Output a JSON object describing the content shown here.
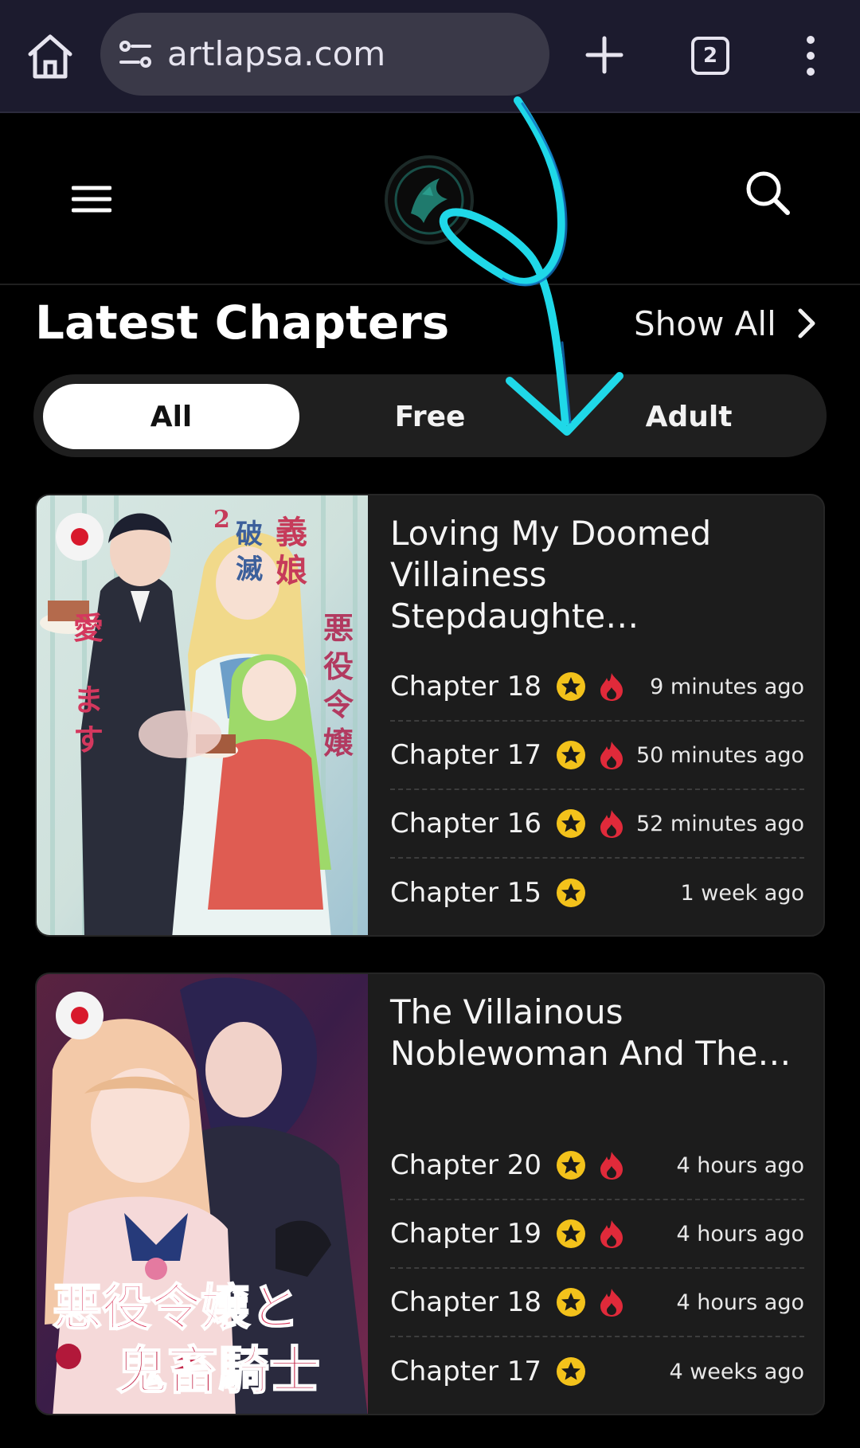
{
  "browser": {
    "url": "artlapsa.com",
    "tab_count": "2"
  },
  "site": {
    "logo_name": "site-logo"
  },
  "section": {
    "title": "Latest Chapters",
    "show_all": "Show All"
  },
  "filters": [
    {
      "label": "All",
      "active": true
    },
    {
      "label": "Free",
      "active": false
    },
    {
      "label": "Adult",
      "active": false
    }
  ],
  "series": [
    {
      "title": "Loving My Doomed Villainess Stepdaughte…",
      "chapters": [
        {
          "label": "Chapter 18",
          "time": "9 minutes ago",
          "star": true,
          "hot": true
        },
        {
          "label": "Chapter 17",
          "time": "50 minutes ago",
          "star": true,
          "hot": true
        },
        {
          "label": "Chapter 16",
          "time": "52 minutes ago",
          "star": true,
          "hot": true
        },
        {
          "label": "Chapter 15",
          "time": "1 week ago",
          "star": true,
          "hot": false
        }
      ]
    },
    {
      "title": "The Villainous Noblewoman And The…",
      "chapters": [
        {
          "label": "Chapter 20",
          "time": "4 hours ago",
          "star": true,
          "hot": true
        },
        {
          "label": "Chapter 19",
          "time": "4 hours ago",
          "star": true,
          "hot": true
        },
        {
          "label": "Chapter 18",
          "time": "4 hours ago",
          "star": true,
          "hot": true
        },
        {
          "label": "Chapter 17",
          "time": "4 weeks ago",
          "star": true,
          "hot": false
        }
      ]
    }
  ],
  "colors": {
    "accent_star": "#f3c21b",
    "hot_red": "#e02a3a",
    "annotation_cyan": "#1fd8e8"
  }
}
